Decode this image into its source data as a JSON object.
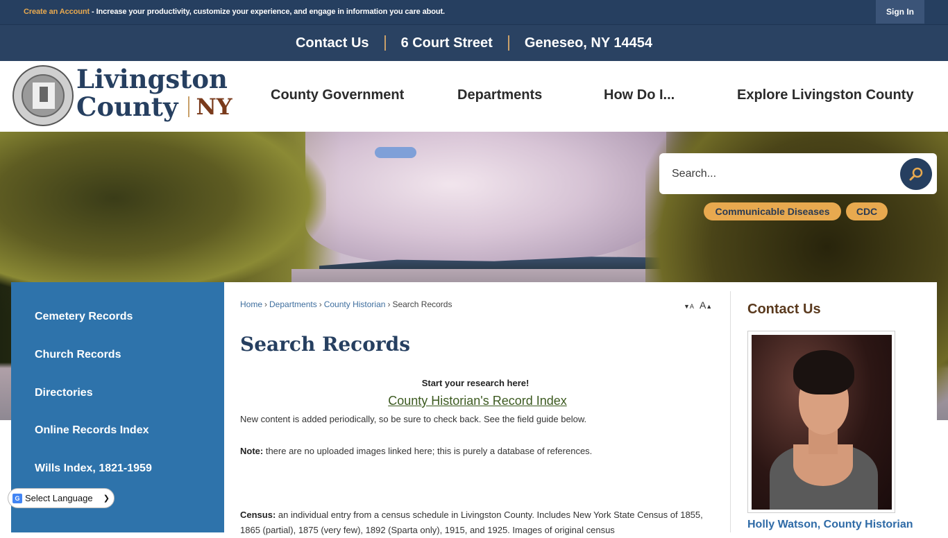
{
  "topbar": {
    "create_account": "Create an Account",
    "promo_text": " - Increase your productivity, customize your experience, and engage in information you care about.",
    "sign_in": "Sign In"
  },
  "contact_bar": {
    "items": [
      "Contact Us",
      "6 Court Street",
      "Geneseo, NY 14454"
    ]
  },
  "header": {
    "logo_line1": "Livingston",
    "logo_line2": "County",
    "logo_state": "NY",
    "seal_alt": "Livingston County New York State seal 1821",
    "nav": [
      "County Government",
      "Departments",
      "How Do I...",
      "Explore Livingston County"
    ]
  },
  "search": {
    "placeholder": "Search...",
    "button_icon": "search-icon",
    "quick_links": [
      "Communicable Diseases",
      "CDC"
    ]
  },
  "sidebar": {
    "items": [
      "Cemetery Records",
      "Church Records",
      "Directories",
      "Online Records Index",
      "Wills Index, 1821-1959"
    ]
  },
  "language": {
    "selected": "Select Language"
  },
  "breadcrumb": {
    "items": [
      "Home",
      "Departments",
      "County Historian"
    ],
    "current": "Search Records",
    "separator": "›"
  },
  "font_controls": {
    "decrease": "A",
    "increase": "A"
  },
  "main": {
    "title": "Search Records",
    "lead": "Start your research here!",
    "record_link": "County Historian's Record Index",
    "para1": "New content is added periodically, so be sure to check back. See the field guide below.",
    "note_label": "Note:",
    "note_text": " there are no uploaded images linked here; this is purely a database of references.",
    "census_label": "Census:",
    "census_text": " an individual entry from a census schedule in Livingston County. Includes New York State Census of 1855, 1865 (partial), 1875 (very few), 1892 (Sparta only), 1915, and 1925. Images of original census"
  },
  "contact": {
    "title": "Contact Us",
    "name": "Holly Watson, County Historian"
  },
  "colors": {
    "navy": "#263f60",
    "gold": "#e8a94f",
    "sidebar_blue": "#2e73ab",
    "brown": "#7a3b1c",
    "link_green": "#3c5a20"
  }
}
